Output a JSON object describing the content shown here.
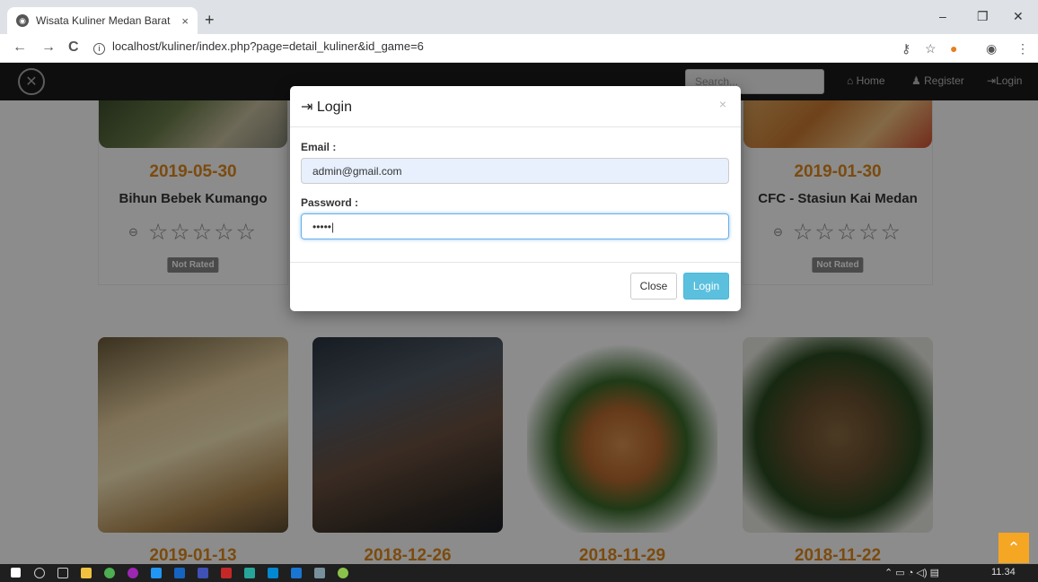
{
  "browser": {
    "tab_title": "Wisata Kuliner Medan Barat",
    "tab_close": "×",
    "new_tab": "+",
    "url": "localhost/kuliner/index.php?page=detail_kuliner&id_game=6",
    "back": "←",
    "forward": "→",
    "reload": "C",
    "minimize": "–",
    "restore": "❐",
    "close": "✕"
  },
  "navbar": {
    "search_placeholder": "Search...",
    "home": "Home",
    "register": "Register",
    "login": "Login"
  },
  "cards_top": [
    {
      "date": "2019-05-30",
      "name": "Bihun Bebek Kumango",
      "stars": "☆☆☆☆☆",
      "rating": "Not Rated"
    },
    {
      "date": "2019-01-30",
      "name": "CFC - Stasiun Kai Medan",
      "stars": "☆☆☆☆☆",
      "rating": "Not Rated"
    }
  ],
  "cards_bottom_dates": [
    "2019-01-13",
    "2018-12-26",
    "2018-11-29",
    "2018-11-22"
  ],
  "modal": {
    "title": "Login",
    "close_x": "×",
    "email_label": "Email :",
    "email_value": "admin@gmail.com",
    "password_label": "Password :",
    "password_value": "•••••",
    "close_button": "Close",
    "login_button": "Login"
  },
  "taskbar": {
    "time": "11.34"
  },
  "colors": {
    "accent_date": "#e0891c",
    "login_button": "#5bc0de",
    "navbar": "#1a1a1a",
    "scroll_top": "#f5a623"
  }
}
